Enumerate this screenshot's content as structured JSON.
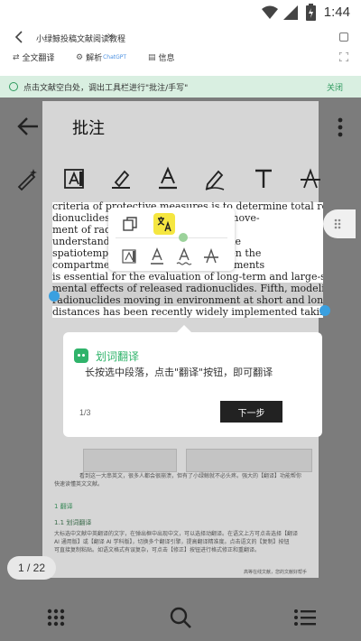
{
  "status_bar": {
    "time": "1:44"
  },
  "app_bar": {
    "doc_title": "小绿鲸投稿文献阅读教程",
    "tabs": [
      {
        "label": "全文翻译"
      },
      {
        "label": "解析",
        "badge": "ChatGPT"
      },
      {
        "label": "信息"
      }
    ]
  },
  "hint_bar": {
    "text": "点击文献空白处，调出工具栏进行\"批注/手写\"",
    "close": "关闭"
  },
  "annotation_bar": {
    "title": "批注"
  },
  "selected_text": {
    "lines": [
      "criteria of protective measures is to determine total release of ra-",
      "dionuclides togethe          aird, to clarify move-",
      "ment of radionucl           is important for",
      "understanding of           uclides because the",
      "spatiotemporal scale         s differ between the",
      "compartments. Four         tween compartments",
      "is essential for the evaluation of long-term and large-scale environ-",
      "mental effects of released radionuclides. Fifth, modeling of released",
      "radionuclides moving in environment at short and long-time scales and",
      "distances has been recently widely implemented taking into account"
    ]
  },
  "tutorial": {
    "title": "划词翻译",
    "description": "长按选中段落，点击\"翻译\"按钮，即可翻译",
    "step": "1/3",
    "next_label": "下一步"
  },
  "background_doc": {
    "para1": "看到这一大串英文，很多人都会很崩溃，但有了小绿鲸就不必头疼。强大的【翻译】功能帮你",
    "para1b": "快速读懂英文文献。",
    "h1": "1 翻译",
    "h2": "1.1 划词翻译",
    "body1": "大标选中文献中英翻译的文字，在弹出框中出现中文，可以选择动翻译。在语文上方可点击选择【翻译",
    "body2": "AI 通用版】或【翻译 AI 学科版】，切换多个翻译引擎，提高翻译精准度。点击语文的【复制】按钮",
    "body3": "可直接复制粘贴。如语文格式有误复杂，可点击【修正】按钮进行格式修正和重翻译。",
    "footer": "高等在线文献，您的文献好帮手"
  },
  "pager": {
    "text": "1 / 22"
  }
}
